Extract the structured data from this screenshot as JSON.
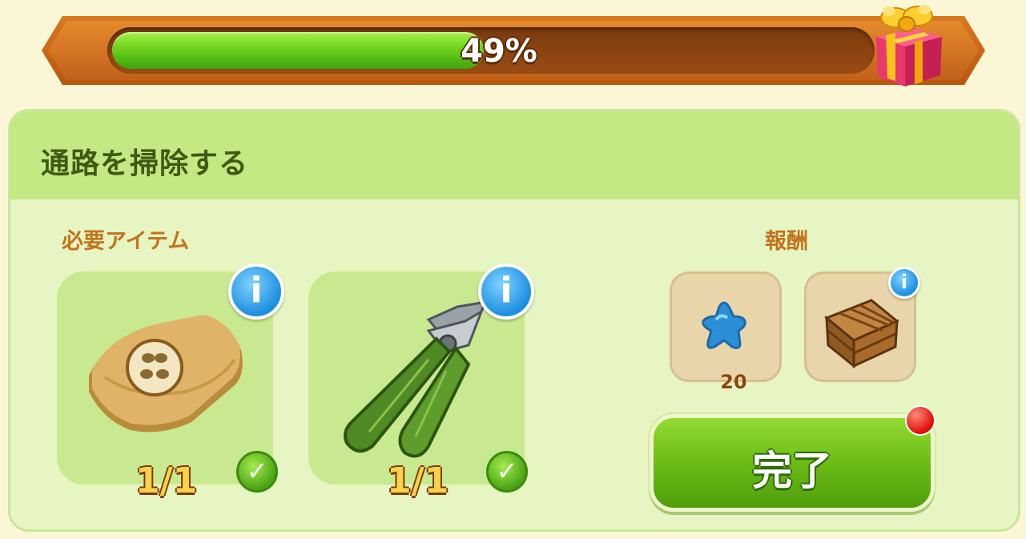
{
  "progress": {
    "value": 0.49,
    "label": "49%"
  },
  "quest": {
    "title": "通路を掃除する"
  },
  "requirements": {
    "label": "必要アイテム",
    "items": [
      {
        "icon": "sandpaper-cloth-icon",
        "count": "1/1",
        "completed": true
      },
      {
        "icon": "pruning-shears-icon",
        "count": "1/1",
        "completed": true
      }
    ]
  },
  "rewards": {
    "label": "報酬",
    "items": [
      {
        "icon": "blue-star-icon",
        "amount": "20"
      },
      {
        "icon": "wooden-crate-icon"
      }
    ]
  },
  "actions": {
    "complete_label": "完了"
  },
  "colors": {
    "progress_fill": "#6cd11a",
    "progress_frame": "#c2601a",
    "panel_bg": "#e6f5c2",
    "header_bg": "#c4e883",
    "title_text": "#3e5a12",
    "section_label": "#c3741e",
    "complete_button": "#6cbc17",
    "info_icon": "#1d8fe0",
    "notification": "#e0140c"
  }
}
